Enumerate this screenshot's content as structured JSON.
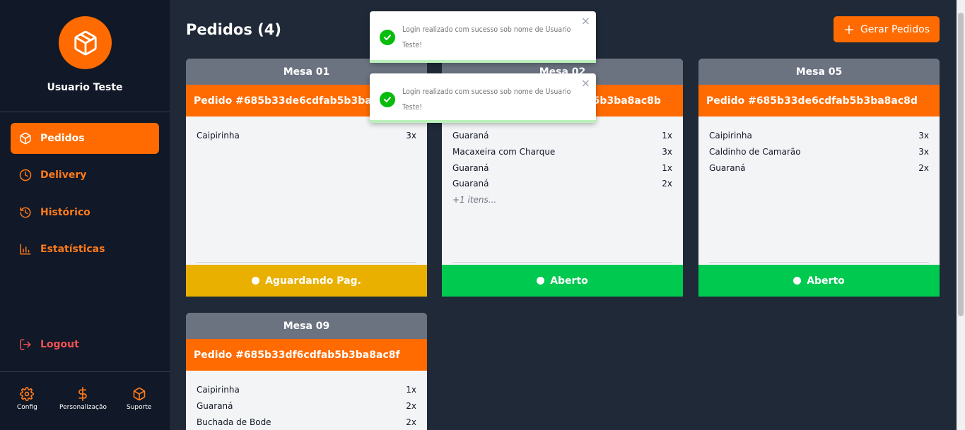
{
  "sidebar": {
    "user_name": "Usuario Teste",
    "nav": {
      "pedidos": "Pedidos",
      "delivery": "Delivery",
      "historico": "Histórico",
      "estatisticas": "Estatísticas",
      "logout": "Logout"
    },
    "footer": {
      "config": "Config",
      "personalizacao": "Personalização",
      "suporte": "Suporte"
    }
  },
  "header": {
    "title": "Pedidos (4)",
    "gen_button": "Gerar Pedidos"
  },
  "toasts": [
    {
      "message": "Login realizado com sucesso sob nome de Usuario Teste!"
    },
    {
      "message": "Login realizado com sucesso sob nome de Usuario Teste!"
    }
  ],
  "cards": [
    {
      "mesa": "Mesa 01",
      "pedido": "Pedido #685b33de6cdfab5b3ba8ac89",
      "items": [
        {
          "name": "Caipirinha",
          "qty": "3x"
        }
      ],
      "more": "",
      "status": "Aguardando Pag.",
      "status_color": "#eab000"
    },
    {
      "mesa": "Mesa 02",
      "pedido": "Pedido #685b33de6cdfab5b3ba8ac8b",
      "items": [
        {
          "name": "Guaraná",
          "qty": "1x"
        },
        {
          "name": "Macaxeira com Charque",
          "qty": "3x"
        },
        {
          "name": "Guaraná",
          "qty": "1x"
        },
        {
          "name": "Guaraná",
          "qty": "2x"
        }
      ],
      "more": "+1 itens...",
      "status": "Aberto",
      "status_color": "#00c950"
    },
    {
      "mesa": "Mesa 05",
      "pedido": "Pedido #685b33de6cdfab5b3ba8ac8d",
      "items": [
        {
          "name": "Caipirinha",
          "qty": "3x"
        },
        {
          "name": "Caldinho de Camarão",
          "qty": "3x"
        },
        {
          "name": "Guaraná",
          "qty": "2x"
        }
      ],
      "more": "",
      "status": "Aberto",
      "status_color": "#00c950"
    },
    {
      "mesa": "Mesa 09",
      "pedido": "Pedido #685b33df6cdfab5b3ba8ac8f",
      "items": [
        {
          "name": "Caipirinha",
          "qty": "1x"
        },
        {
          "name": "Guaraná",
          "qty": "2x"
        },
        {
          "name": "Buchada de Bode",
          "qty": "2x"
        }
      ],
      "more": "",
      "status": "",
      "status_color": ""
    }
  ],
  "colors": {
    "accent": "#ff6b00",
    "sidebar_bg": "#111827",
    "main_bg": "#1f2937",
    "card_header": "#6b7280",
    "logout": "#f05252"
  }
}
